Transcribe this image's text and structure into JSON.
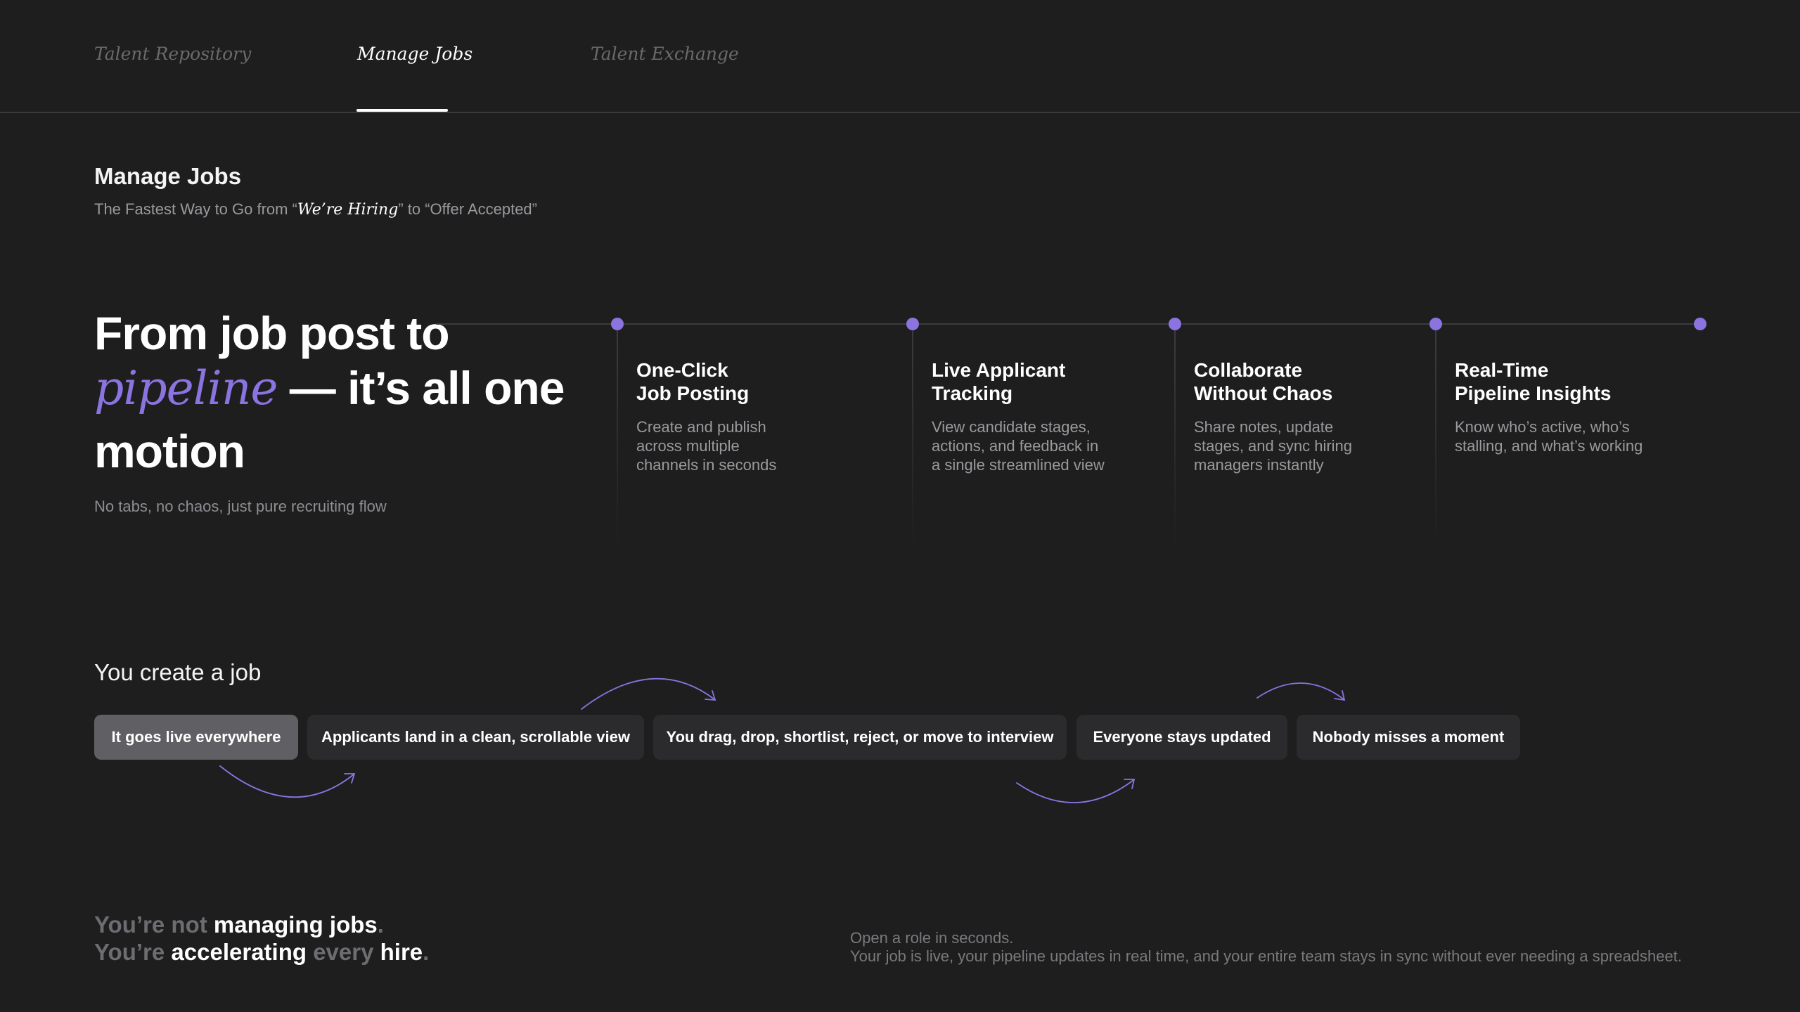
{
  "tabs": [
    {
      "label": "Talent Repository",
      "active": false
    },
    {
      "label": "Manage Jobs",
      "active": true
    },
    {
      "label": "Talent Exchange",
      "active": false
    }
  ],
  "header": {
    "title": "Manage Jobs",
    "subtitle_pre": "The Fastest Way to Go from “",
    "subtitle_em": "We’re Hiring",
    "subtitle_post": "” to “Offer Accepted”"
  },
  "hero": {
    "line1": "From job post to",
    "accent": "pipeline",
    "line2_rest": " — it’s all one",
    "line3": "motion",
    "sub": "No tabs, no chaos, just pure recruiting flow"
  },
  "steps": [
    {
      "title": "One-Click\nJob Posting",
      "desc": "Create and publish\nacross multiple\nchannels in seconds"
    },
    {
      "title": "Live Applicant\nTracking",
      "desc": "View candidate stages,\nactions, and feedback in\na single streamlined view"
    },
    {
      "title": "Collaborate\nWithout Chaos",
      "desc": "Share notes, update\nstages, and sync hiring\nmanagers instantly"
    },
    {
      "title": "Real-Time\nPipeline Insights",
      "desc": "Know who’s active, who’s\nstalling, and what’s working"
    }
  ],
  "flow": {
    "title": "You create a job",
    "steps": [
      {
        "label": "It goes live everywhere",
        "active": true
      },
      {
        "label": "Applicants land in a clean, scrollable view",
        "active": false
      },
      {
        "label": "You drag, drop, shortlist, reject, or move to interview",
        "active": false
      },
      {
        "label": "Everyone stays updated",
        "active": false
      },
      {
        "label": "Nobody misses a moment",
        "active": false
      }
    ]
  },
  "footer": {
    "tagline1": {
      "a": "You’re not ",
      "b": "managing jobs",
      "c": "."
    },
    "tagline2": {
      "a": "You’re ",
      "b": "accelerating",
      "c": " every ",
      "d": "hire",
      "e": "."
    },
    "text1": "Open a role in seconds.",
    "text2": "Your job is live, your pipeline updates in real time, and your entire team stays in sync  without ever needing a spreadsheet."
  },
  "colors": {
    "background": "#1e1e1f",
    "accent": "#8b74e0",
    "active_pill": "#606064",
    "pill": "#2b2b2e"
  }
}
